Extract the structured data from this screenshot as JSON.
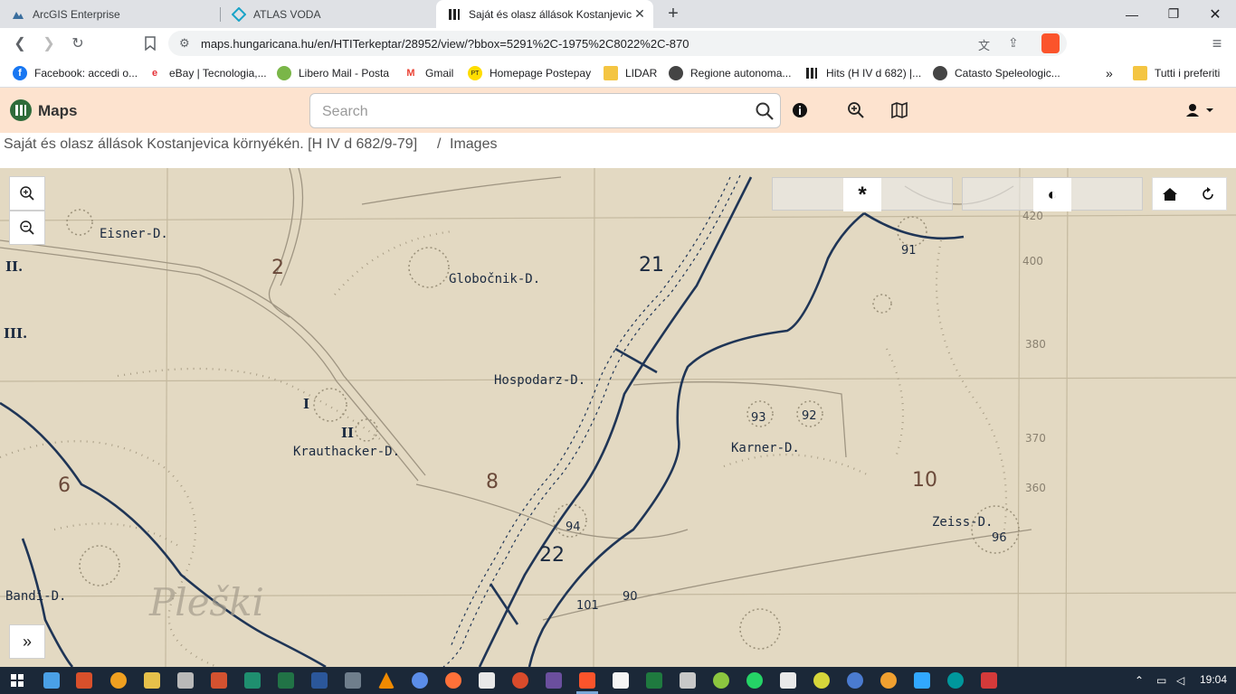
{
  "browser": {
    "tabs": [
      {
        "title": "ArcGIS Enterprise",
        "active": false
      },
      {
        "title": "ATLAS VODA",
        "active": false
      },
      {
        "title": "Saját és olasz állások Kostanjevic",
        "active": true
      }
    ],
    "url": "maps.hungaricana.hu/en/HTITerkeptar/28952/view/?bbox=5291%2C-1975%2C8022%2C-870",
    "bookmarks": [
      "Facebook: accedi o...",
      "eBay | Tecnologia,...",
      "Libero Mail - Posta",
      "Gmail",
      "Homepage Postepay",
      "LIDAR",
      "Regione autonoma...",
      "Hits (H IV d 682) |...",
      "Catasto Speleologic...",
      "Tutti i preferiti"
    ]
  },
  "app": {
    "name": "Maps",
    "search_placeholder": "Search",
    "breadcrumb_title": "Saját és olasz állások Kostanjevica környékén. [H IV d 682/9-79]",
    "breadcrumb_sep": "/",
    "breadcrumb_current": "Images"
  },
  "map": {
    "labels": [
      {
        "text": "Eisner-D.",
        "kind": "place"
      },
      {
        "text": "Globočnik-D.",
        "kind": "place"
      },
      {
        "text": "Hospodarz-D.",
        "kind": "place"
      },
      {
        "text": "Krauthacker-D.",
        "kind": "place"
      },
      {
        "text": "Karner-D.",
        "kind": "place"
      },
      {
        "text": "Zeiss-D.",
        "kind": "place"
      },
      {
        "text": "Bandi-D.",
        "kind": "place"
      },
      {
        "text": "Pleški",
        "kind": "region"
      },
      {
        "text": "2",
        "kind": "sector"
      },
      {
        "text": "21",
        "kind": "sector"
      },
      {
        "text": "22",
        "kind": "sector"
      },
      {
        "text": "8",
        "kind": "sector"
      },
      {
        "text": "6",
        "kind": "sector"
      },
      {
        "text": "10",
        "kind": "sector"
      },
      {
        "text": "II.",
        "kind": "roman"
      },
      {
        "text": "III.",
        "kind": "roman"
      },
      {
        "text": "I",
        "kind": "roman"
      },
      {
        "text": "II",
        "kind": "roman"
      },
      {
        "text": "91",
        "kind": "point"
      },
      {
        "text": "93",
        "kind": "point"
      },
      {
        "text": "92",
        "kind": "point"
      },
      {
        "text": "94",
        "kind": "point"
      },
      {
        "text": "96",
        "kind": "point"
      },
      {
        "text": "90",
        "kind": "point"
      },
      {
        "text": "101",
        "kind": "point"
      },
      {
        "text": "420",
        "kind": "coord"
      },
      {
        "text": "400",
        "kind": "coord"
      },
      {
        "text": "380",
        "kind": "coord"
      },
      {
        "text": "370",
        "kind": "coord"
      },
      {
        "text": "360",
        "kind": "coord"
      }
    ],
    "colors": {
      "paper": "#e3d9c2",
      "front_line": "#1f3556",
      "grid": "#c9bfa6"
    }
  },
  "taskbar": {
    "time": "19:04"
  }
}
